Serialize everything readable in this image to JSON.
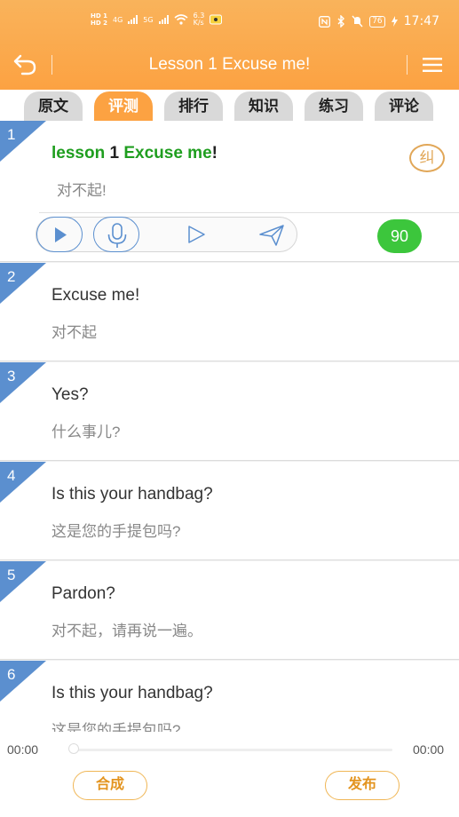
{
  "status_bar": {
    "hd1": "HD 1",
    "hd2": "HD 2",
    "net1": "4G",
    "net2": "5G",
    "speed_value": "6.3",
    "speed_unit": "K/s",
    "battery": "76",
    "time": "17:47",
    "icons": [
      "signal-icon",
      "wifi-icon",
      "notification-app-icon",
      "nfc-icon",
      "bluetooth-icon",
      "mute-icon",
      "charging-icon"
    ]
  },
  "navbar": {
    "title": "Lesson 1 Excuse me!",
    "back_icon": "back-arrow-icon",
    "menu_icon": "menu-icon"
  },
  "tabs": [
    {
      "label": "原文",
      "active": false
    },
    {
      "label": "评测",
      "active": true
    },
    {
      "label": "排行",
      "active": false
    },
    {
      "label": "知识",
      "active": false
    },
    {
      "label": "练习",
      "active": false
    },
    {
      "label": "评论",
      "active": false
    }
  ],
  "sentences": [
    {
      "num": "1",
      "en_word1": "lesson",
      "en_num": "1",
      "en_word2": "Excuse me",
      "en_punct": "!",
      "cn": "对不起!",
      "score": "90",
      "correct_label": "纠"
    },
    {
      "num": "2",
      "en": "Excuse me!",
      "cn": "对不起"
    },
    {
      "num": "3",
      "en": "Yes?",
      "cn": "什么事儿?"
    },
    {
      "num": "4",
      "en": "Is this your handbag?",
      "cn": "这是您的手提包吗?"
    },
    {
      "num": "5",
      "en": "Pardon?",
      "cn": "对不起，请再说一遍。"
    },
    {
      "num": "6",
      "en": "Is this your handbag?",
      "cn": "这是您的手提包吗?"
    }
  ],
  "player": {
    "current_time": "00:00",
    "total_time": "00:00",
    "progress": 0,
    "compose_label": "合成",
    "publish_label": "发布"
  },
  "colors": {
    "header": "#fca242",
    "accent_blue": "#5b8fcf",
    "score_green": "#3cc63c",
    "word_green": "#1f9e1f"
  }
}
